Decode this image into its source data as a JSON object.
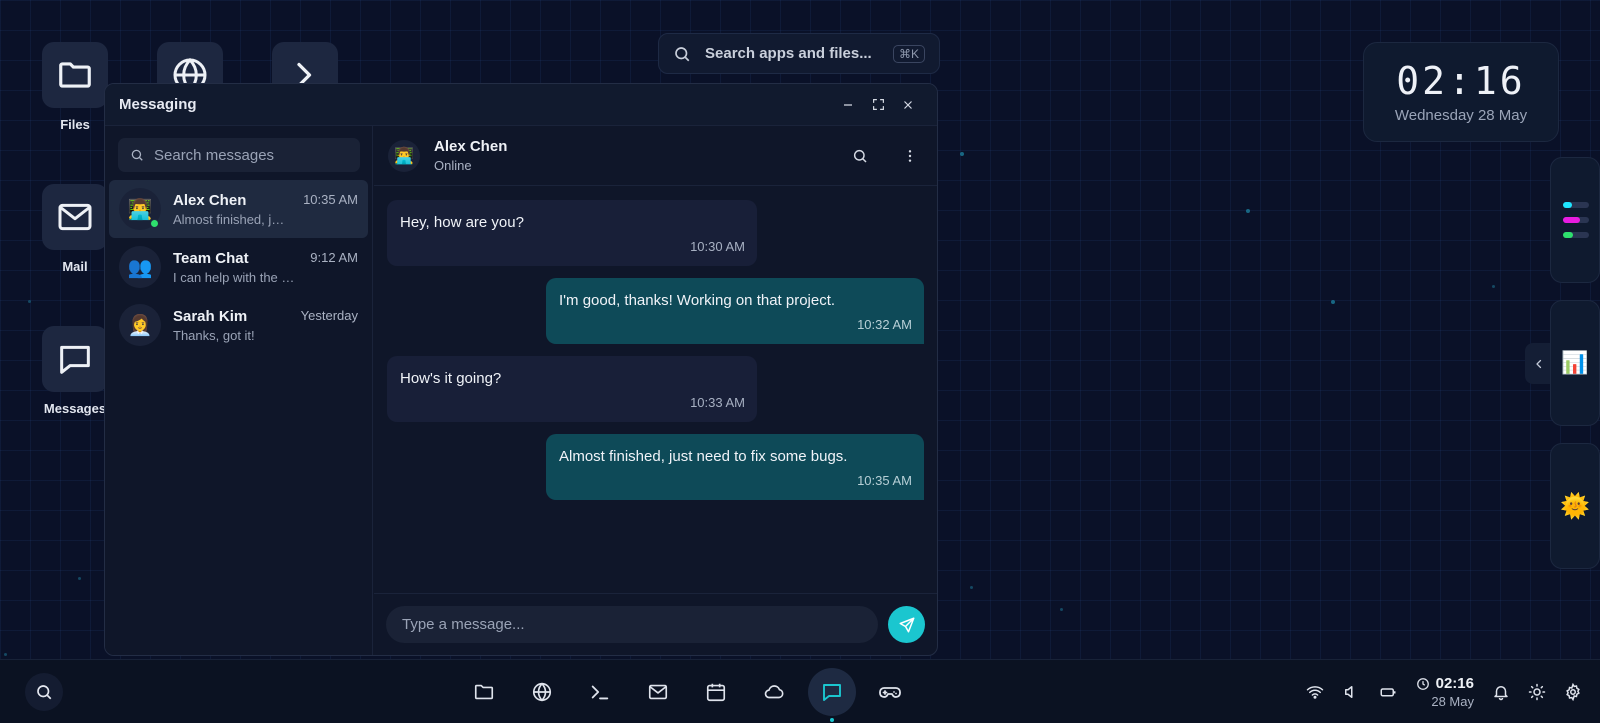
{
  "desktop": {
    "icons": [
      {
        "label": "Files",
        "icon": "folder-icon"
      },
      {
        "label": "",
        "icon": "globe-icon"
      },
      {
        "label": "",
        "icon": "terminal-icon"
      },
      {
        "label": "Mail",
        "icon": "mail-icon"
      },
      {
        "label": "Messages",
        "icon": "message-icon"
      }
    ]
  },
  "top_search": {
    "placeholder": "Search apps and files...",
    "shortcut": "⌘K"
  },
  "clock_widget": {
    "time": "02:16",
    "date": "Wednesday 28 May"
  },
  "messaging": {
    "title": "Messaging",
    "search_placeholder": "Search messages",
    "conversations": [
      {
        "name": "Alex Chen",
        "preview": "Almost finished, just need to fix some bugs.",
        "time": "10:35 AM",
        "avatar": "👨‍💻",
        "online": true,
        "active": true
      },
      {
        "name": "Team Chat",
        "preview": "I can help with the design.",
        "time": "9:12 AM",
        "avatar": "👥",
        "online": false,
        "active": false
      },
      {
        "name": "Sarah Kim",
        "preview": "Thanks, got it!",
        "time": "Yesterday",
        "avatar": "👩‍💼",
        "online": false,
        "active": false
      }
    ],
    "chat": {
      "name": "Alex Chen",
      "status": "Online",
      "avatar": "👨‍💻",
      "messages": [
        {
          "text": "Hey, how are you?",
          "time": "10:30 AM",
          "direction": "in"
        },
        {
          "text": "I'm good, thanks! Working on that project.",
          "time": "10:32 AM",
          "direction": "out"
        },
        {
          "text": "How's it going?",
          "time": "10:33 AM",
          "direction": "in"
        },
        {
          "text": "Almost finished, just need to fix some bugs.",
          "time": "10:35 AM",
          "direction": "out"
        }
      ],
      "composer_placeholder": "Type a message..."
    }
  },
  "right_widgets": {
    "chart_emoji": "📊",
    "weather_emoji": "🌞"
  },
  "taskbar": {
    "apps": [
      "folder-icon",
      "globe-icon",
      "terminal-icon",
      "mail-icon",
      "calendar-icon",
      "cloud-icon",
      "message-icon",
      "gamepad-icon"
    ],
    "active_app": "message-icon",
    "clock_time": "02:16",
    "clock_date": "28 May"
  },
  "colors": {
    "accent": "#1bc6cf",
    "outgoing_bubble": "#0e4a58",
    "incoming_bubble": "#181f38",
    "online": "#2ee06e"
  }
}
